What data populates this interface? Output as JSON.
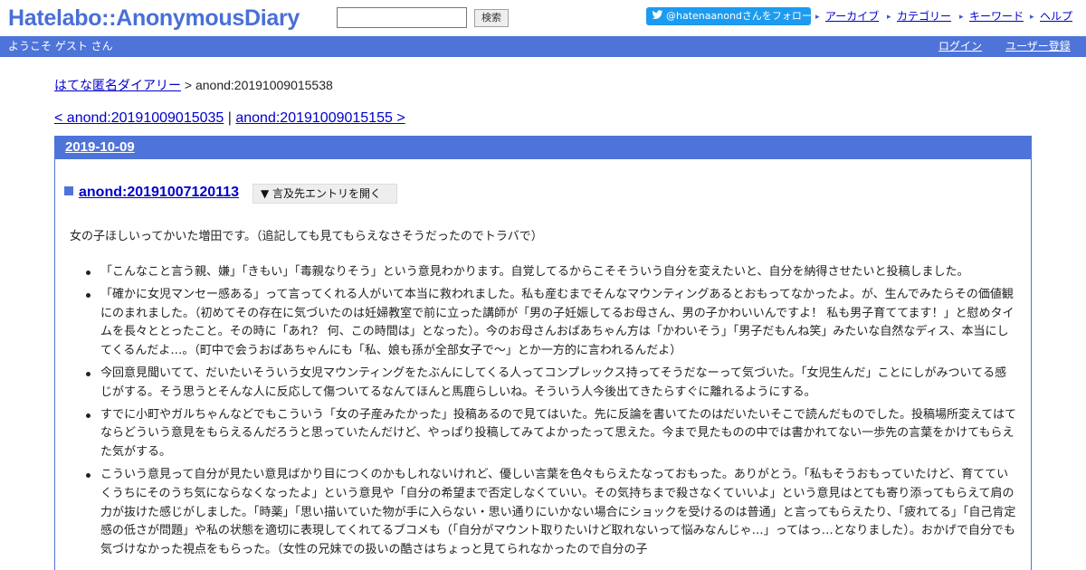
{
  "header": {
    "logo": "Hatelabo::AnonymousDiary",
    "search_button": "検索",
    "search_value": "",
    "follow": "@hatenaanondさんをフォロー",
    "links": [
      "アーカイブ",
      "カテゴリー",
      "キーワード",
      "ヘルプ"
    ]
  },
  "userbar": {
    "welcome": "ようこそ ゲスト さん",
    "login": "ログイン",
    "register": "ユーザー登録"
  },
  "breadcrumb": {
    "home": "はてな匿名ダイアリー",
    "separator": " > ",
    "current": "anond:20191009015538"
  },
  "pager": {
    "prev": "< anond:20191009015035",
    "separator": " | ",
    "next": "anond:20191009015155 >"
  },
  "day": {
    "date": "2019-10-09"
  },
  "entry": {
    "title": "anond:20191007120113",
    "mention_button": "▼ 言及先エントリを開く",
    "intro": "女の子ほしいってかいた増田です。（追記しても見てもらえなさそうだったのでトラバで）",
    "comments": [
      "「こんなこと言う親、嫌」「きもい」「毒親なりそう」という意見わかります。自覚してるからこそそういう自分を変えたいと、自分を納得させたいと投稿しました。",
      "「確かに女児マンセー感ある」って言ってくれる人がいて本当に救われました。私も産むまでそんなマウンティングあるとおもってなかったよ。が、生んでみたらその価値観にのまれました。（初めてその存在に気づいたのは妊婦教室で前に立った講師が「男の子妊娠してるお母さん、男の子かわいいんですよ！ 私も男子育ててます！」と慰めタイムを長々ととったこと。その時に「あれ？ 何、この時間は」となった）。今のお母さんおばあちゃん方は「かわいそう」「男子だもんね笑」みたいな自然なディス、本当にしてくるんだよ…。（町中で会うおばあちゃんにも「私、娘も孫が全部女子で〜」とか一方的に言われるんだよ）",
      "今回意見聞いてて、だいたいそういう女児マウンティングをたぶんにしてくる人ってコンプレックス持ってそうだなーって気づいた。「女児生んだ」ことにしがみついてる感じがする。そう思うとそんな人に反応して傷ついてるなんてほんと馬鹿らしいね。そういう人今後出てきたらすぐに離れるようにする。",
      "すでに小町やガルちゃんなどでもこういう「女の子産みたかった」投稿あるので見てはいた。先に反論を書いてたのはだいたいそこで読んだものでした。投稿場所変えてはてならどういう意見をもらえるんだろうと思っていたんだけど、やっぱり投稿してみてよかったって思えた。今まで見たものの中では書かれてない一歩先の言葉をかけてもらえた気がする。",
      "こういう意見って自分が見たい意見ばかり目につくのかもしれないけれど、優しい言葉を色々もらえたなっておもった。ありがとう。「私もそうおもっていたけど、育てていくうちにそのうち気にならなくなったよ」という意見や「自分の希望まで否定しなくていい。その気持ちまで殺さなくていいよ」という意見はとても寄り添ってもらえて肩の力が抜けた感じがしました。「時薬」「思い描いていた物が手に入らない・思い通りにいかない場合にショックを受けるのは普通」と言ってもらえたり、「疲れてる」「自己肯定感の低さが問題」や私の状態を適切に表現してくれてるブコメも（「自分がマウント取りたいけど取れないって悩みなんじゃ…」ってはっ…となりました）。おかげで自分でも気づけなかった視点をもらった。（女性の兄妹での扱いの酷さはちょっと見てられなかったので自分の子"
    ]
  },
  "colors": {
    "brand_blue": "#4e74d9",
    "link": "#0000cc",
    "twitter": "#1d9bf0"
  }
}
